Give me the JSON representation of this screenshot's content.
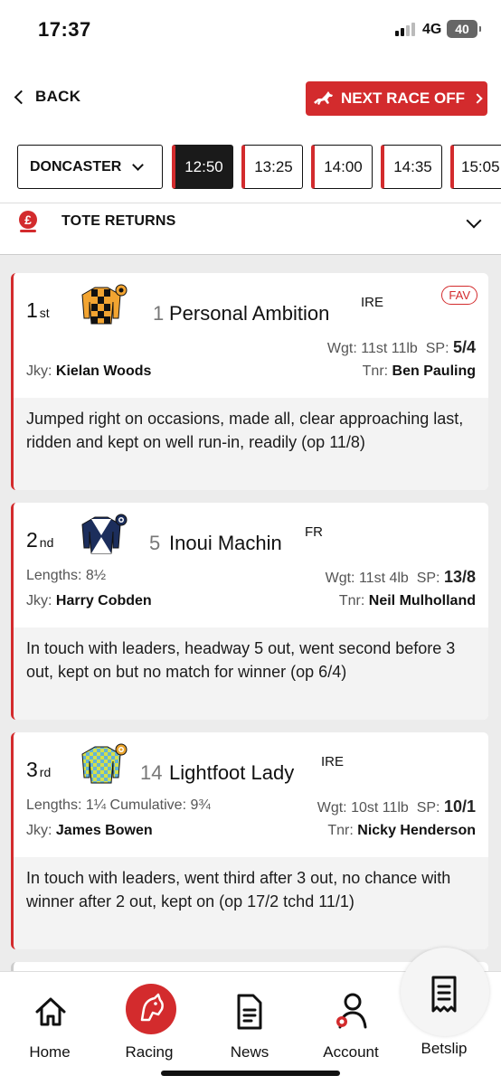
{
  "status_bar": {
    "time": "17:37",
    "network": "4G",
    "battery": "40"
  },
  "nav": {
    "back_label": "BACK",
    "next_race_label": "NEXT RACE OFF"
  },
  "venue": {
    "selected": "DONCASTER"
  },
  "race_times": [
    "12:50",
    "13:25",
    "14:00",
    "14:35",
    "15:05"
  ],
  "active_time": "12:50",
  "tote": {
    "label": "TOTE RETURNS"
  },
  "results": [
    {
      "position": "1",
      "ordinal": "st",
      "number": "1",
      "name": "Personal Ambition",
      "country": "IRE",
      "badge": "FAV",
      "lengths": "",
      "cumulative": "",
      "weight_label": "Wgt:",
      "weight": "11st 11lb",
      "sp_label": "SP:",
      "sp": "5/4",
      "jockey_label": "Jky:",
      "jockey": "Kielan Woods",
      "trainer_label": "Tnr:",
      "trainer": "Ben Pauling",
      "comment": "Jumped right on occasions, made all, clear approaching last, ridden and kept on well run-in, readily (op 11/8)"
    },
    {
      "position": "2",
      "ordinal": "nd",
      "number": "5",
      "name": "Inoui Machin",
      "country": "FR",
      "badge": "",
      "lengths_label": "Lengths:",
      "lengths": "8½",
      "cumulative": "",
      "weight_label": "Wgt:",
      "weight": "11st 4lb",
      "sp_label": "SP:",
      "sp": "13/8",
      "jockey_label": "Jky:",
      "jockey": "Harry Cobden",
      "trainer_label": "Tnr:",
      "trainer": "Neil Mulholland",
      "comment": "In touch with leaders, headway 5 out, went second before 3 out, kept on but no match for winner (op 6/4)"
    },
    {
      "position": "3",
      "ordinal": "rd",
      "number": "14",
      "name": "Lightfoot Lady",
      "country": "IRE",
      "badge": "",
      "lengths_label": "Lengths:",
      "lengths": "1¼",
      "cumulative_label": "Cumulative:",
      "cumulative": "9¾",
      "weight_label": "Wgt:",
      "weight": "10st 11lb",
      "sp_label": "SP:",
      "sp": "10/1",
      "jockey_label": "Jky:",
      "jockey": "James Bowen",
      "trainer_label": "Tnr:",
      "trainer": "Nicky Henderson",
      "comment": "In touch with leaders, went third after 3 out, no chance with winner after 2 out, kept on (op 17/2 tchd 11/1)"
    }
  ],
  "tabs": [
    {
      "label": "Home",
      "icon": "home-icon"
    },
    {
      "label": "Racing",
      "icon": "horse-head-icon"
    },
    {
      "label": "News",
      "icon": "document-icon"
    },
    {
      "label": "Account",
      "icon": "person-gear-icon"
    },
    {
      "label": "Betslip",
      "icon": "receipt-icon"
    }
  ],
  "colors": {
    "accent": "#d32b2d"
  }
}
